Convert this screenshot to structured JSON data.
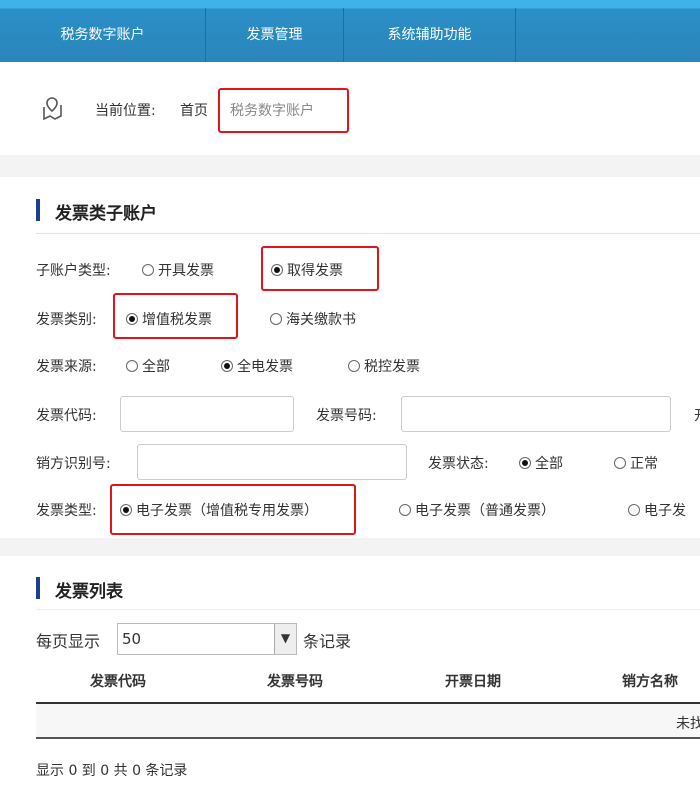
{
  "nav": {
    "items": [
      "税务数字账户",
      "发票管理",
      "系统辅助功能"
    ]
  },
  "breadcrumb": {
    "label": "当前位置:",
    "home": "首页",
    "current": "税务数字账户"
  },
  "filter": {
    "title": "发票类子账户",
    "account_type": {
      "label": "子账户类型:",
      "options": [
        "开具发票",
        "取得发票"
      ],
      "selected": 1
    },
    "category": {
      "label": "发票类别:",
      "options": [
        "增值税发票",
        "海关缴款书"
      ],
      "selected": 0
    },
    "source": {
      "label": "发票来源:",
      "options": [
        "全部",
        "全电发票",
        "税控发票"
      ],
      "selected": 1
    },
    "code_label": "发票代码:",
    "number_label": "发票号码:",
    "cut_label": "开",
    "seller_id_label": "销方识别号:",
    "status": {
      "label": "发票状态:",
      "options": [
        "全部",
        "正常"
      ],
      "selected": 0
    },
    "type": {
      "label": "发票类型:",
      "options": [
        "电子发票（增值税专用发票）",
        "电子发票（普通发票）",
        "电子发"
      ],
      "selected": 0
    }
  },
  "list": {
    "title": "发票列表",
    "page_size_prefix": "每页显示",
    "page_size": "50",
    "page_size_suffix": "条记录",
    "columns": [
      "发票代码",
      "发票号码",
      "开票日期",
      "销方名称"
    ],
    "empty_text": "未找",
    "footer": "显示 0 到 0 共 0 条记录"
  }
}
